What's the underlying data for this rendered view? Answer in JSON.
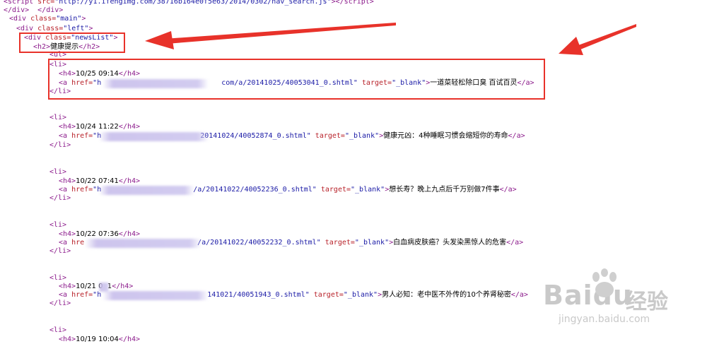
{
  "header": {
    "script_src": "\"http://y1.ifengimg.com/38716b164e0f5e63/2014/0302/nav_search.js\""
  },
  "section": {
    "div_newslist": "\"newsList\"",
    "h2_text": "健康提示"
  },
  "items": [
    {
      "time": "10/25 09:14",
      "url": "com/a/20141025/40053041_0.shtml\"",
      "title": "一道菜轻松除口臭 百试百灵"
    },
    {
      "time": "10/24 11:22",
      "url": "20141024/40052874_0.shtml\"",
      "title": "健康元凶：4种睡眠习惯会缩短你的寿命"
    },
    {
      "time": "10/22 07:41",
      "url": "/a/20141022/40052236_0.shtml\"",
      "title": "想长寿？晚上九点后千万别做7件事"
    },
    {
      "time": "10/22 07:36",
      "url": "/a/20141022/40052232_0.shtml\"",
      "title": "白血病皮肤癌？头发染黑惊人的危害"
    },
    {
      "time": "10/21 0  1",
      "url": "141021/40051943_0.shtml\"",
      "title": "男人必知：老中医不外传的10个养肾秘密"
    },
    {
      "time": "10/19 10:04",
      "url": "",
      "title": ""
    }
  ],
  "watermark": {
    "brand": "Baidu",
    "cn": "经验",
    "url": "jingyan.baidu.com"
  },
  "colors": {
    "annotation": "#e8322a",
    "tag": "#8b1a8b",
    "attr": "#b8222a",
    "value": "#1a1aa6"
  }
}
